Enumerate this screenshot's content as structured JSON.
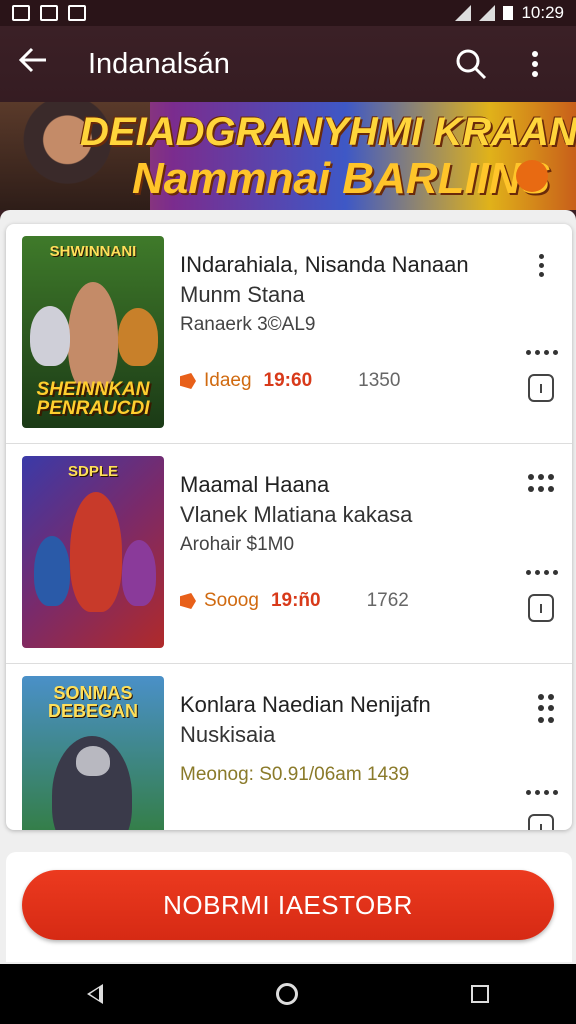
{
  "status_bar": {
    "time": "10:29"
  },
  "app_bar": {
    "title": "Indanalsán"
  },
  "banner": {
    "line1": "DEIADGRANYHMI KRAAN",
    "line2": "Nammnai BARLIINS"
  },
  "games": [
    {
      "thumb_top": "SHWINNANI",
      "thumb_label": "SHEINNKAN PENRAUCDI",
      "title": "INdarahiala, Nisanda Nanaan",
      "subtitle": "Munm Stana",
      "meta": "Ranaerk 3©AL9",
      "tag": "Idaeg",
      "time": "19:60",
      "count": "1350",
      "colors": {
        "bg1": "#3f7a2a",
        "bg2": "#1b3a16",
        "accent": "#e8a22a"
      }
    },
    {
      "thumb_top": "SDPLE",
      "thumb_label": "",
      "title": "Maamal Haana",
      "subtitle": "Vlanek Mlatiana kakasa",
      "meta": "Arohair $1M0",
      "tag": "Sooog",
      "time": "19:ñ0",
      "count": "1762",
      "colors": {
        "bg1": "#3a3aa8",
        "bg2": "#b02a2a",
        "accent": "#e84a1a"
      }
    },
    {
      "thumb_top": "SONMAS DEBEGAN",
      "thumb_label": "",
      "title": "Konlara Naedian Nenijafn",
      "subtitle": "Nuskisaia",
      "meta": "",
      "info_line": "Meonog: S0.91/06am 1439",
      "colors": {
        "bg1": "#4a90c8",
        "bg2": "#2f7a2a",
        "accent": "#e8b82a"
      }
    }
  ],
  "cta": {
    "label": "NOBRMI IAESTOBR"
  }
}
